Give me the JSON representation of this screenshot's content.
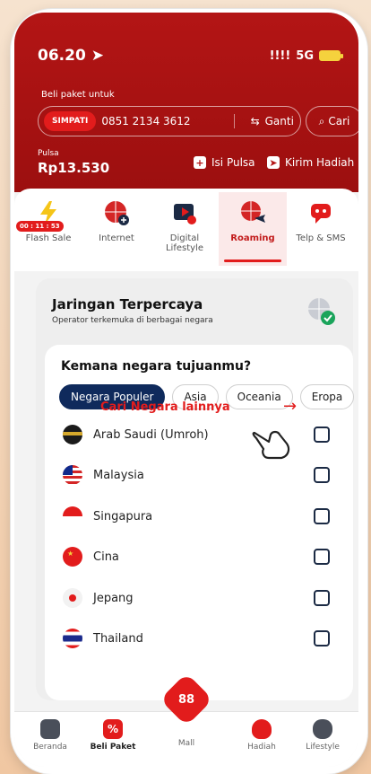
{
  "status": {
    "time": "06.20",
    "network": "5G",
    "signal": "!!!!"
  },
  "header": {
    "beli_label": "Beli paket untuk",
    "badge": "SIMPATI",
    "phone_number": "0851 2134 3612",
    "ganti_label": "Ganti",
    "cari_label": "Cari",
    "pulsa_label": "Pulsa",
    "pulsa_value": "Rp13.530",
    "isi_pulsa": "Isi Pulsa",
    "kirim_hadiah": "Kirim Hadiah"
  },
  "categories": [
    {
      "label": "Flash Sale",
      "timer": "00 : 11 : 53"
    },
    {
      "label": "Internet"
    },
    {
      "label": "Digital Lifestyle"
    },
    {
      "label": "Roaming"
    },
    {
      "label": "Telp & SMS"
    }
  ],
  "roaming": {
    "title": "Jaringan Terpercaya",
    "subtitle": "Operator terkemuka di berbagai negara",
    "question": "Kemana negara tujuanmu?",
    "chips": [
      "Negara Populer",
      "Asia",
      "Oceania",
      "Eropa"
    ],
    "countries": [
      {
        "name": "Arab Saudi (Umroh)"
      },
      {
        "name": "Malaysia"
      },
      {
        "name": "Singapura"
      },
      {
        "name": "Cina"
      },
      {
        "name": "Jepang"
      },
      {
        "name": "Thailand"
      }
    ],
    "cari_lain": "Cari Negara lainnya"
  },
  "bottom_nav": [
    "Beranda",
    "Beli Paket",
    "Mall",
    "Hadiah",
    "Lifestyle"
  ],
  "colors": {
    "primary_red": "#e21c1c",
    "header_red": "#b31515",
    "navy": "#0f2a5c"
  }
}
